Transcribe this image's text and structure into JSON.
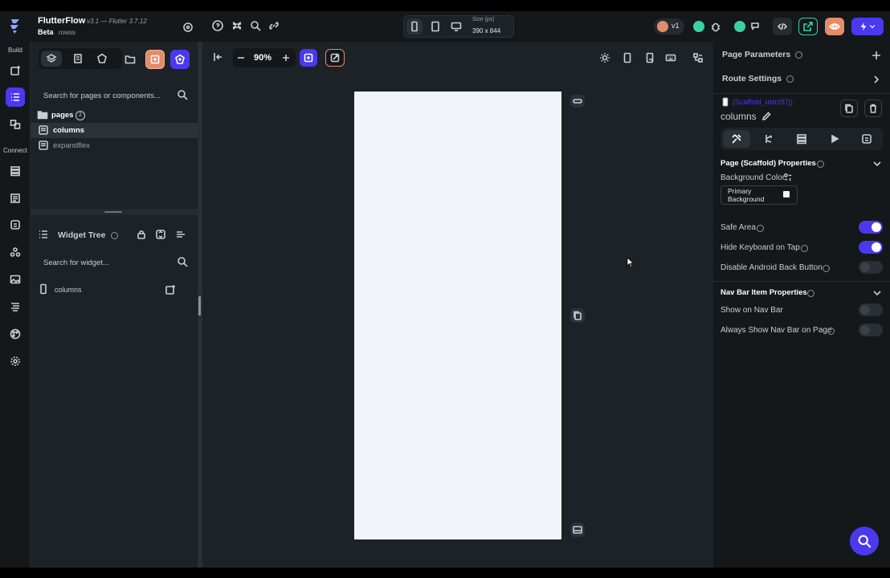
{
  "app": {
    "name": "FlutterFlow",
    "version": "v3.1 — Flutter 3.7.12",
    "beta_label": "Beta",
    "project_name": "rowss"
  },
  "device": {
    "size_label": "Size (px)",
    "size_value": "390 x 844"
  },
  "toolbar": {
    "version_badge": "v1",
    "zoom": "90%"
  },
  "rail": {
    "build_label": "Build",
    "connect_label": "Connect"
  },
  "left": {
    "search_placeholder": "Search for pages or components...",
    "pages_folder": "pages",
    "pages_count": "2",
    "pages": [
      "columns",
      "expandflex"
    ],
    "widget_tree_title": "Widget Tree",
    "widget_search_placeholder": "Search for widget...",
    "tree_root": "columns"
  },
  "right": {
    "page_parameters": "Page Parameters",
    "route_settings": "Route Settings",
    "scaffold_id": "(Scaffold_ustrz87j)",
    "page_name": "columns",
    "props_title": "Page (Scaffold) Properties",
    "bg_color_label": "Background Color",
    "bg_color_value_line1": "Primary",
    "bg_color_value_line2": "Background",
    "safe_area": "Safe Area",
    "hide_keyboard": "Hide Keyboard on Tap",
    "disable_back": "Disable Android Back Button",
    "nav_title": "Nav Bar Item Properties",
    "show_nav": "Show on Nav Bar",
    "always_show_nav": "Always Show Nav Bar on Page"
  },
  "toggles": {
    "safe_area": true,
    "hide_keyboard": true,
    "disable_back": false,
    "show_nav": false,
    "always_show_nav": false
  },
  "colors": {
    "accent": "#4b39ef",
    "canvas_page": "#f1f4f8",
    "success": "#39d2a0",
    "orange": "#e58b6a"
  }
}
